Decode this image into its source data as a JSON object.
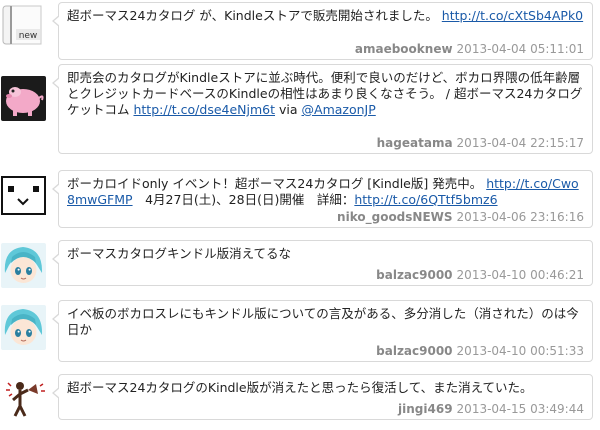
{
  "tweets": [
    {
      "text": "超ボーマス24カタログ が、Kindleストアで販売開始されました。 ",
      "link1": "http://t.co/cXtSb4APk0",
      "user": "amaebooknew",
      "time": "2013-04-04 05:11:01",
      "avatar": "new-book-icon",
      "avatar_label": "new"
    },
    {
      "text": "即売会のカタログがKindleストアに並ぶ時代。便利で良いのだけど、ボカロ界隈の低年齢層とクレジットカードベースのKindleの相性はあまり良くなさそう。 / 超ボーマス24カタログ ケットコム ",
      "link1": "http://t.co/dse4eNjm6t",
      "via": " via ",
      "link2": "@AmazonJP",
      "user": "hageatama",
      "time": "2013-04-04 22:15:17",
      "avatar": "pink-pig-character-avatar"
    },
    {
      "text": "ボーカロイドonly イベント！超ボーマス24カタログ [Kindle版] 発売中。 ",
      "link1": "http://t.co/Cwo8mwGFMP",
      "text2": "　4月27日(土)、28日(日)開催　詳細：",
      "link2": "http://t.co/6QTtf5bmz6",
      "user": "niko_goodsNEWS",
      "time": "2013-04-06 23:16:16",
      "avatar": "box-face-avatar"
    },
    {
      "text": "ボーマスカタログキンドル版消えてるな",
      "user": "balzac9000",
      "time": "2013-04-10 00:46:21",
      "avatar": "blue-hair-character-avatar"
    },
    {
      "text": "イベ板のボカロスレにもキンドル版についての言及がある、多分消した（消された）のは今日か",
      "user": "balzac9000",
      "time": "2013-04-10 00:51:33",
      "avatar": "blue-hair-character-avatar"
    },
    {
      "text": "超ボーマス24カタログのKindle版が消えたと思ったら復活して、また消えていた。",
      "user": "jingi469",
      "time": "2013-04-15 03:49:44",
      "avatar": "megaphone-figure-avatar"
    }
  ],
  "colors": {
    "link": "#1a5aa8",
    "meta": "#999999",
    "border": "#d9d9d9"
  }
}
